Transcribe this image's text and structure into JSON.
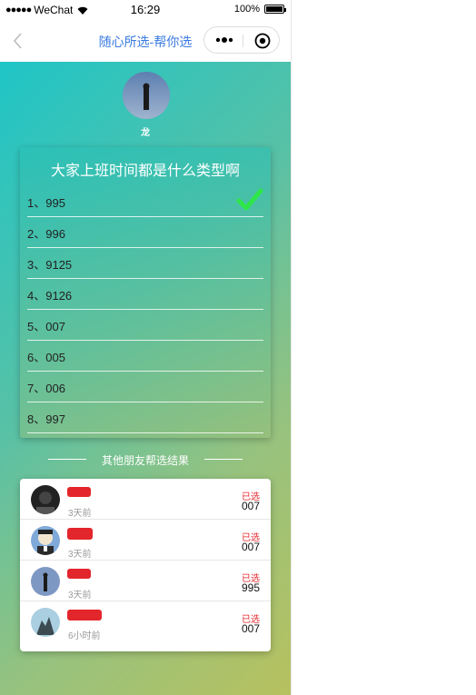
{
  "status_bar": {
    "carrier": "WeChat",
    "time": "16:29",
    "battery": "100%"
  },
  "nav": {
    "title": "随心所选-帮你选",
    "icons": [
      "back-chevron-icon",
      "more-dots-icon",
      "close-circle-icon"
    ]
  },
  "author": {
    "name": "龙"
  },
  "question": {
    "title": "大家上班时间都是什么类型啊",
    "options": [
      {
        "label": "1、995",
        "selected": true
      },
      {
        "label": "2、996",
        "selected": false
      },
      {
        "label": "3、9125",
        "selected": false
      },
      {
        "label": "4、9126",
        "selected": false
      },
      {
        "label": "5、007",
        "selected": false
      },
      {
        "label": "6、005",
        "selected": false
      },
      {
        "label": "7、006",
        "selected": false
      },
      {
        "label": "8、997",
        "selected": false
      }
    ]
  },
  "results": {
    "heading": "其他朋友帮选结果",
    "rows": [
      {
        "time": "3天前",
        "picked_label": "已选",
        "picked_value": "007"
      },
      {
        "time": "3天前",
        "picked_label": "已选",
        "picked_value": "007"
      },
      {
        "time": "3天前",
        "picked_label": "已选",
        "picked_value": "995"
      },
      {
        "time": "6小时前",
        "picked_label": "已选",
        "picked_value": "007"
      }
    ]
  },
  "colors": {
    "nav_title": "#3a7be0",
    "check": "#2ee64a",
    "picked_label": "#e3262b",
    "gradient_start": "#1fc5c7",
    "gradient_end": "#b7c15f"
  }
}
